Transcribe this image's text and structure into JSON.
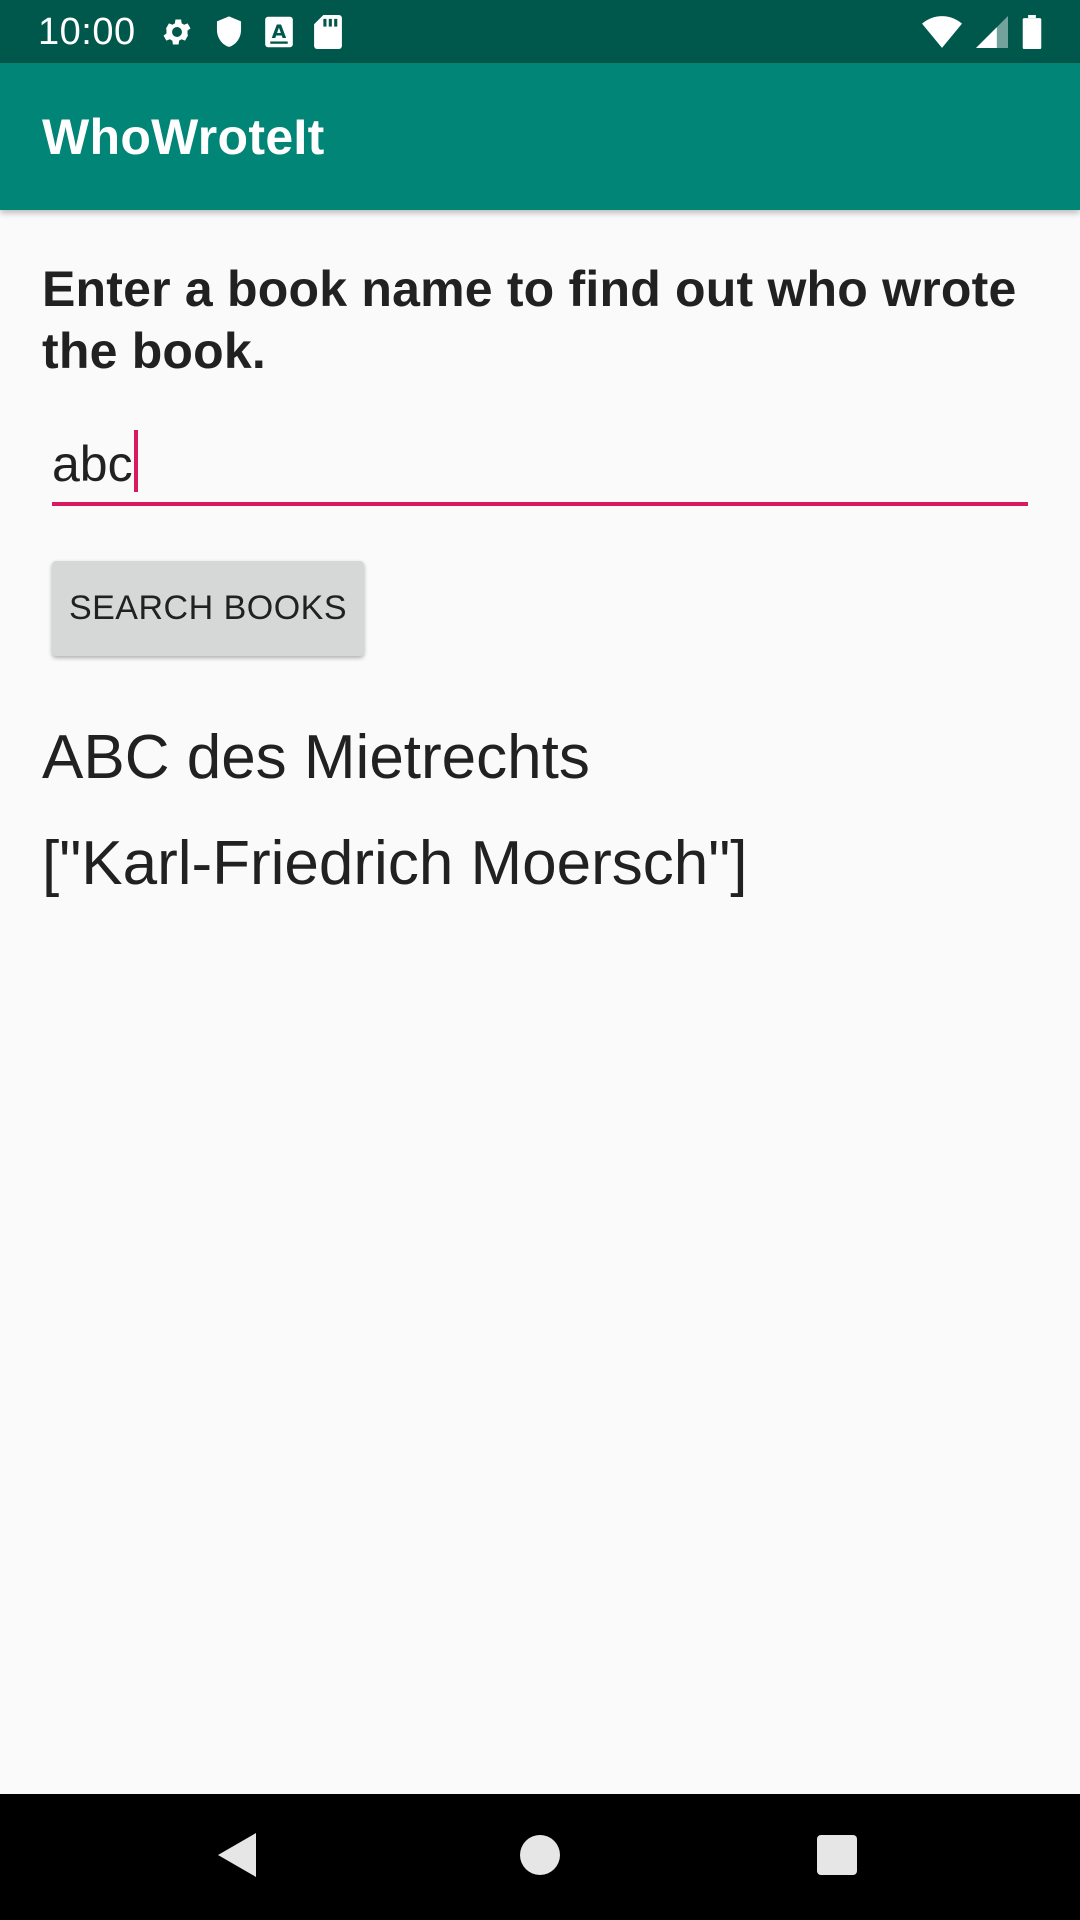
{
  "status_bar": {
    "time": "10:00",
    "left_icons": [
      "settings-icon",
      "shield-icon",
      "a-keyboard-icon",
      "sd-card-icon"
    ],
    "right_icons": [
      "wifi-icon",
      "cell-signal-icon",
      "battery-icon"
    ],
    "background_color": "#00574b"
  },
  "app_bar": {
    "title": "WhoWroteIt",
    "background_color": "#008577"
  },
  "main": {
    "instructions": "Enter a book name to find out who wrote the book.",
    "book_input": {
      "value": "abc",
      "underline_color": "#d81b60"
    },
    "search_button_label": "SEARCH BOOKS",
    "result_title": "ABC des Mietrechts",
    "result_author": "[\"Karl-Friedrich Moersch\"]"
  },
  "nav_bar": {
    "buttons": [
      "back-icon",
      "home-icon",
      "recents-icon"
    ]
  }
}
